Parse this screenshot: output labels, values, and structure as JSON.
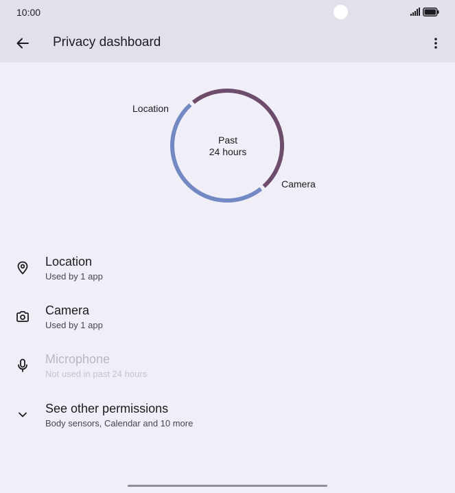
{
  "status_bar": {
    "time": "10:00",
    "icons": [
      "signal-icon",
      "battery-icon"
    ]
  },
  "app_bar": {
    "title": "Privacy dashboard",
    "back_icon": "arrow-left-icon",
    "overflow_icon": "more-vert-icon"
  },
  "chart_data": {
    "type": "pie",
    "center_text": [
      "Past",
      "24 hours"
    ],
    "categories": [
      "Location",
      "Camera"
    ],
    "values": [
      1,
      1
    ],
    "colors": {
      "Location": "#6e4c6c",
      "Camera": "#7389c4"
    }
  },
  "permissions": [
    {
      "title": "Location",
      "subtitle": "Used by 1 app",
      "icon": "location-pin-icon",
      "enabled": true
    },
    {
      "title": "Camera",
      "subtitle": "Used by 1 app",
      "icon": "camera-icon",
      "enabled": true
    },
    {
      "title": "Microphone",
      "subtitle": "Not used in past 24 hours",
      "icon": "microphone-icon",
      "enabled": false
    },
    {
      "title": "See other permissions",
      "subtitle": "Body sensors, Calendar and 10 more",
      "icon": "chevron-down-icon",
      "enabled": true
    }
  ],
  "colors": {
    "background": "#f0eef6",
    "app_bar": "#e1e1ec",
    "location_arc": "#6e4c6c",
    "camera_arc": "#7389c4"
  }
}
